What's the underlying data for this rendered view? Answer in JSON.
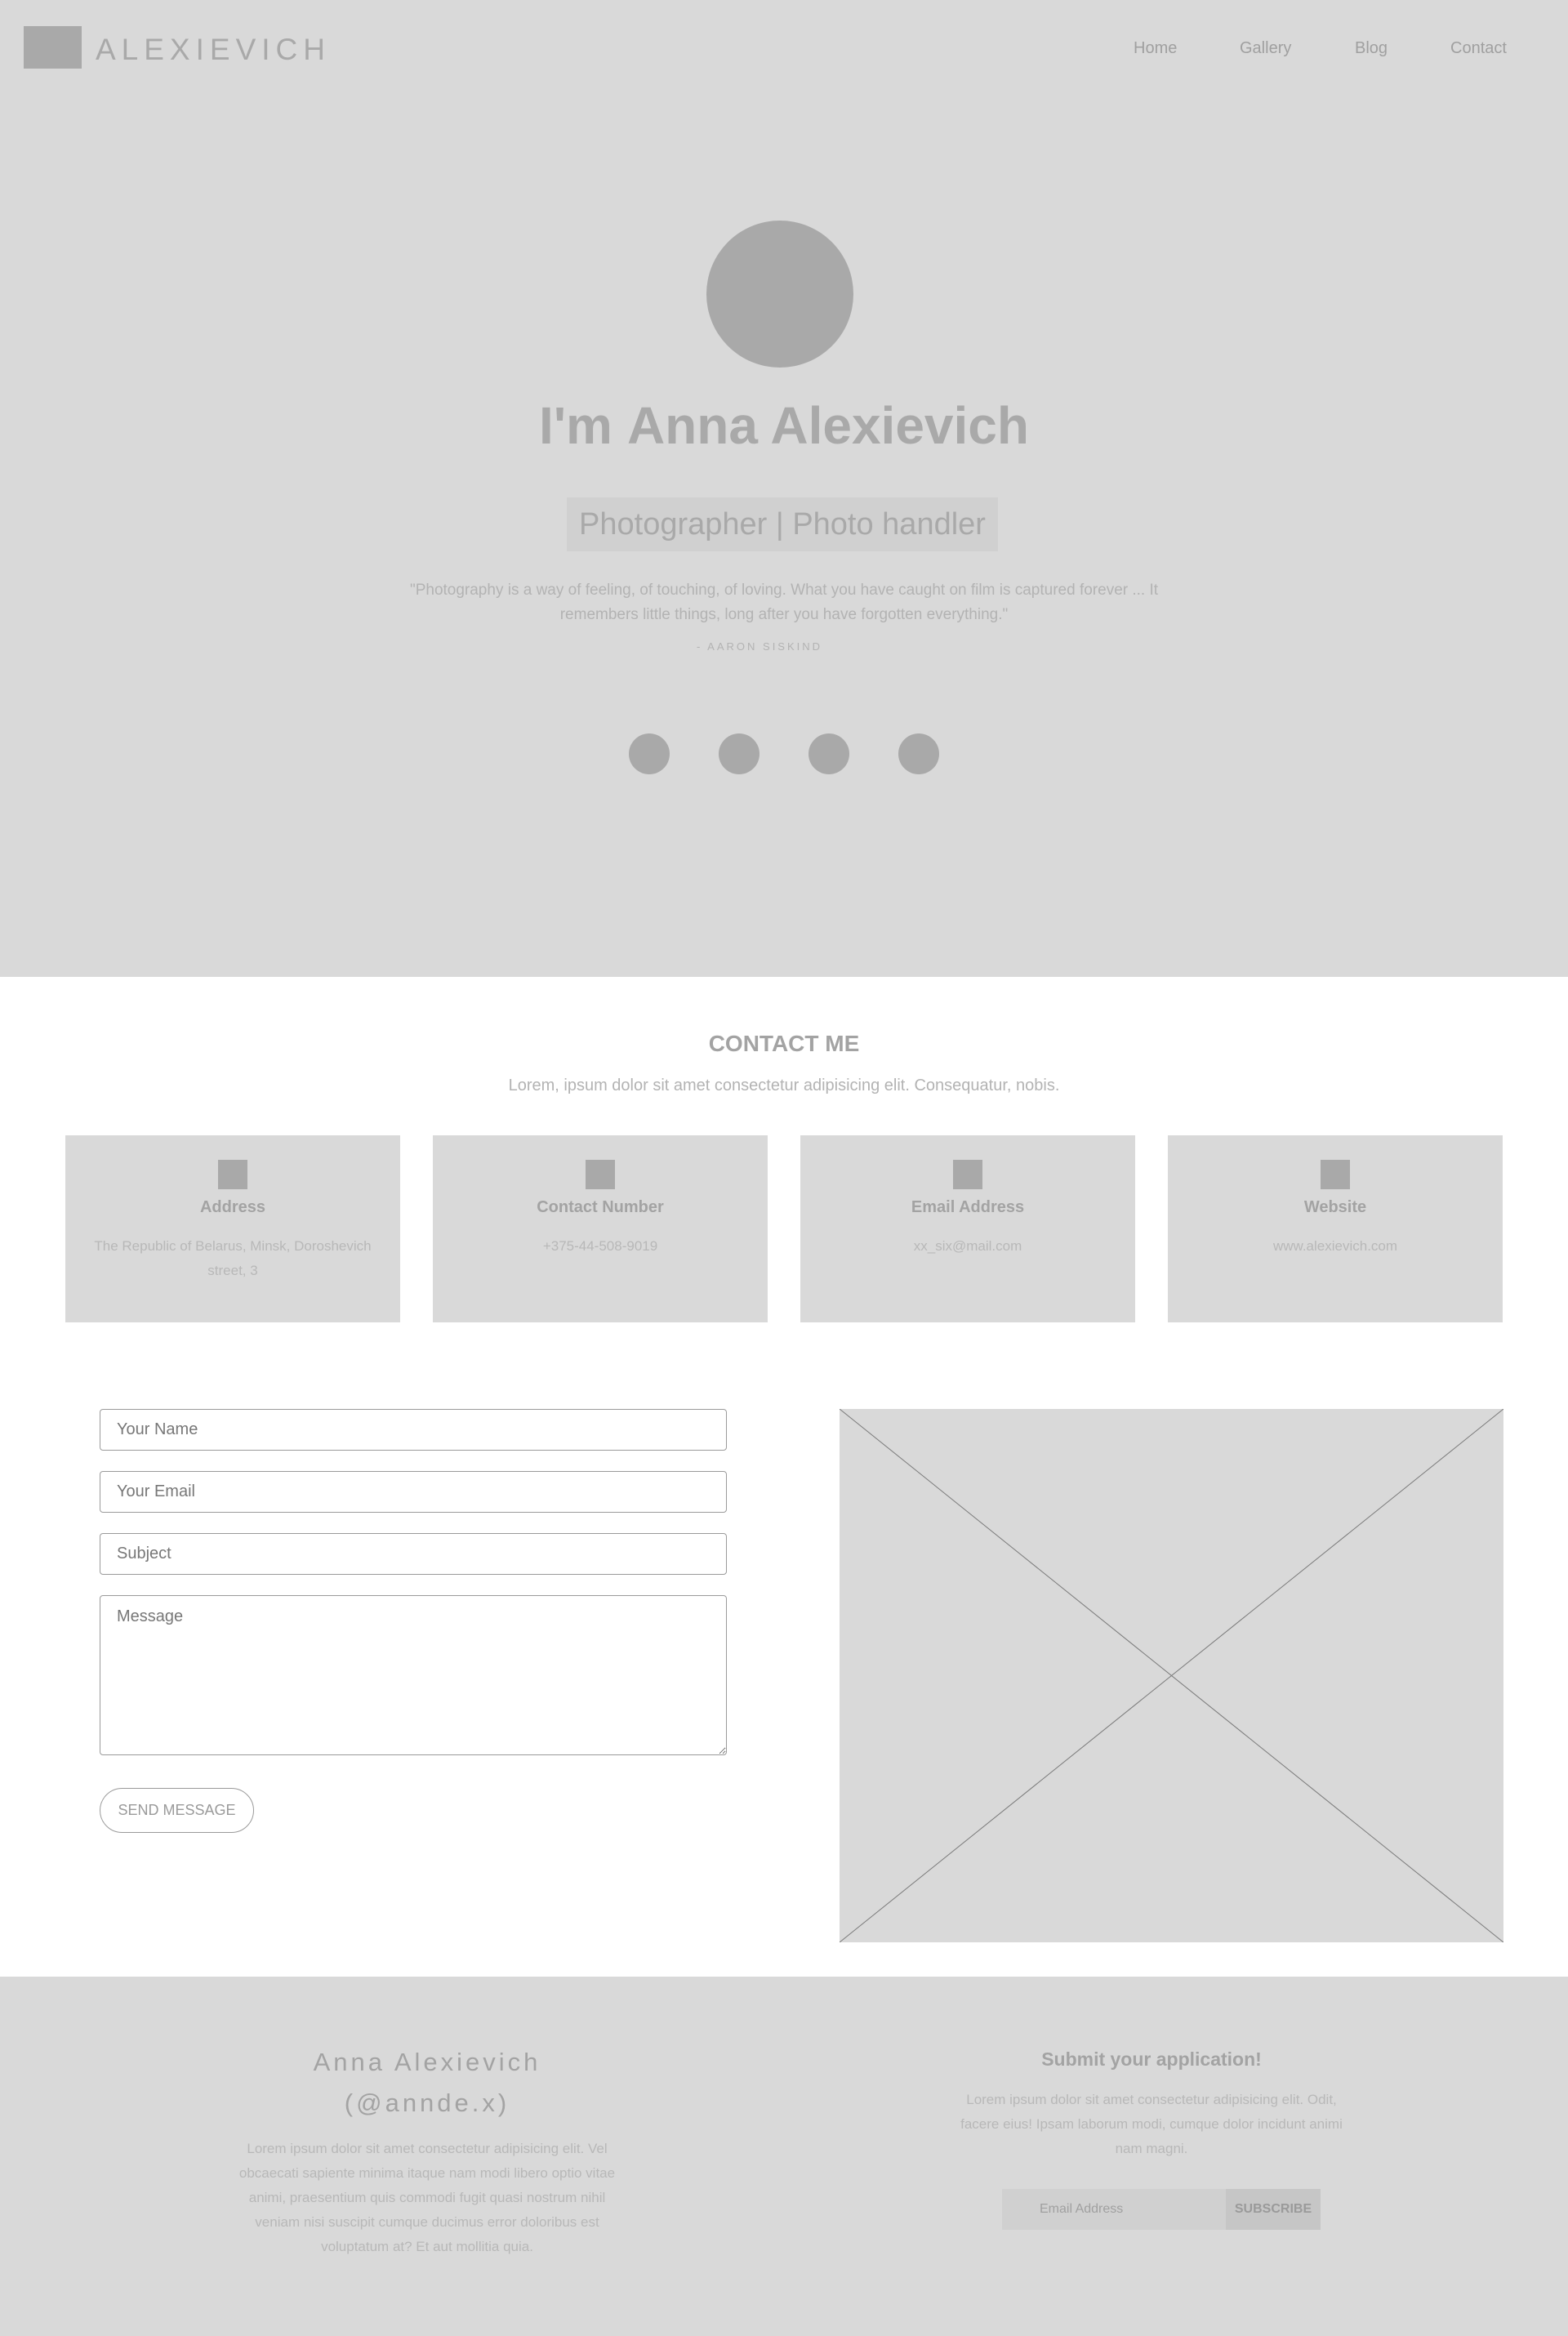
{
  "header": {
    "brand": "ALEXIEVICH",
    "nav": [
      "Home",
      "Gallery",
      "Blog",
      "Contact"
    ]
  },
  "hero": {
    "prefix": "I'm",
    "name": "Anna Alexievich",
    "role": "Photographer | Photo handler",
    "quote": "\"Photography is a way of feeling, of touching, of loving. What you have caught on film is captured forever ... It remembers little things, long after you have forgotten everything.\"",
    "quote_author": "- AARON SISKIND"
  },
  "contact": {
    "title": "CONTACT ME",
    "subtitle": "Lorem, ipsum dolor sit amet consectetur adipisicing elit. Consequatur, nobis.",
    "cards": [
      {
        "title": "Address",
        "text": "The Republic of Belarus, Minsk, Doroshevich street, 3"
      },
      {
        "title": "Contact Number",
        "text": "+375-44-508-9019"
      },
      {
        "title": "Email Address",
        "text": "xx_six@mail.com"
      },
      {
        "title": "Website",
        "text": "www.alexievich.com"
      }
    ],
    "form": {
      "name_placeholder": "Your Name",
      "email_placeholder": "Your Email",
      "subject_placeholder": "Subject",
      "message_placeholder": "Message",
      "send_label": "SEND MESSAGE"
    }
  },
  "footer": {
    "name": "Anna Alexievich",
    "handle": "(@annde.x)",
    "text": "Lorem ipsum dolor sit amet consectetur adipisicing elit. Vel obcaecati sapiente minima itaque nam modi libero optio vitae animi, praesentium quis commodi fugit quasi nostrum nihil veniam nisi suscipit cumque ducimus error doloribus est voluptatum at? Et aut mollitia quia.",
    "app_title": "Submit your application!",
    "app_text": "Lorem ipsum dolor sit amet consectetur adipisicing elit. Odit, facere eius! Ipsam laborum modi, cumque dolor incidunt animi nam magni.",
    "email_placeholder": "Email Address",
    "subscribe_label": "SUBSCRIBE"
  },
  "colors": {
    "placeholder_gray": "#d9d9d9",
    "shape_gray": "#a9a9a9",
    "text_gray": "#a3a3a3"
  }
}
